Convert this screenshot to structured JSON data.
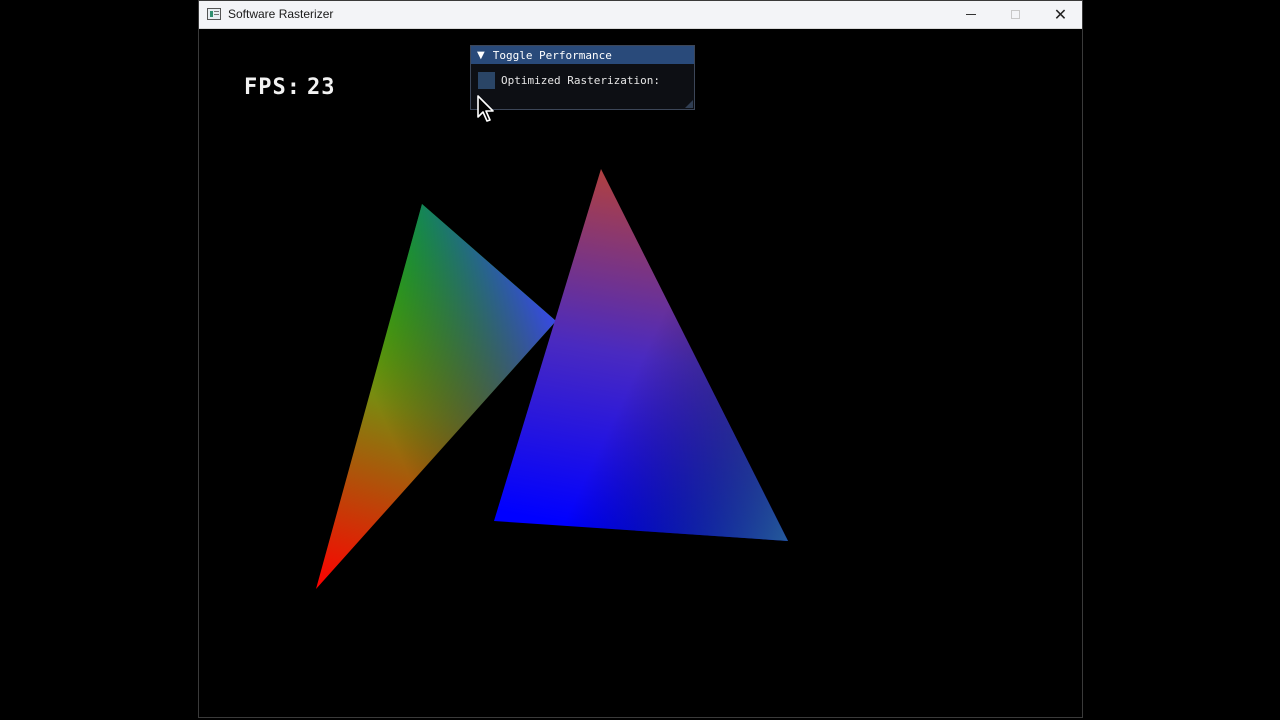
{
  "window": {
    "title": "Software Rasterizer",
    "app_icon": "app-window-icon",
    "controls": {
      "minimize_icon": "minimize-icon",
      "maximize_icon": "maximize-icon",
      "close_icon": "close-icon",
      "close_glyph": "✕"
    }
  },
  "hud": {
    "fps_label": "FPS:",
    "fps_value": "23"
  },
  "imgui": {
    "panel_title": "Toggle Performance",
    "collapse_glyph": "▼",
    "checkbox_label": "Optimized Rasterization:",
    "checkbox_checked": false,
    "header_color": "#294a7a",
    "checkbox_color": "#2a4566"
  },
  "scene": {
    "background": "#000000",
    "triangle_left_colors": [
      "#00ff00",
      "#ff0000",
      "#3a3aff"
    ],
    "triangle_right_colors": [
      "#b04040",
      "#0000ff",
      "#2a6a8a"
    ]
  }
}
